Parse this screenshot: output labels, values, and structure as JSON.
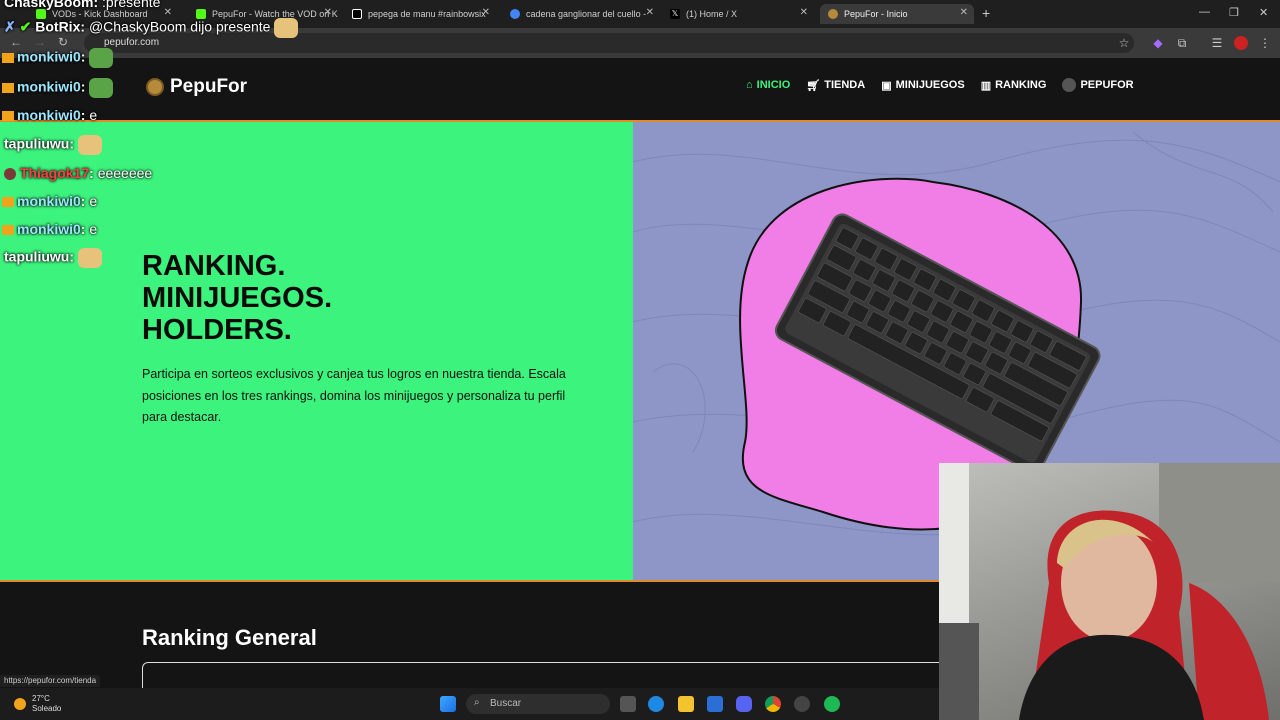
{
  "browser": {
    "tabs": [
      {
        "label": "VODs - Kick Dashboard",
        "color": "#53fc18"
      },
      {
        "label": "PepuFor - Watch the VOD on K",
        "color": "#53fc18"
      },
      {
        "label": "pepega de manu #rainbowsix",
        "color": "#ffffff"
      },
      {
        "label": "cadena ganglionar del cuello -",
        "color": "#4285f4"
      },
      {
        "label": "(1) Home / X",
        "color": "#ffffff"
      },
      {
        "label": "PepuFor - Inicio",
        "color": "#b58a3a"
      }
    ],
    "url": "pepufor.com"
  },
  "site": {
    "logo_text": "PepuFor",
    "nav": [
      {
        "label": "INICIO",
        "icon": "home-icon"
      },
      {
        "label": "TIENDA",
        "icon": "cart-icon"
      },
      {
        "label": "MINIJUEGOS",
        "icon": "gamepad-icon"
      },
      {
        "label": "RANKING",
        "icon": "chart-icon"
      },
      {
        "label": "PEPUFOR",
        "icon": "user-icon"
      }
    ],
    "hero": {
      "title_lines": [
        "RANKING.",
        "MINIJUEGOS.",
        "HOLDERS."
      ],
      "description": "Participa en sorteos exclusivos y canjea tus logros en nuestra tienda. Escala posiciones en los tres rankings, domina los minijuegos y personaliza tu perfil para destacar."
    },
    "ranking_title": "Ranking General"
  },
  "chat": [
    {
      "user": "ChaskyBoom",
      "text": ":presente",
      "color": "#ffffff"
    },
    {
      "user": "BotRix",
      "text": "@ChaskyBoom dijo presente",
      "color": "#ffffff"
    },
    {
      "user": "monkiwi0",
      "text": "",
      "color": "#9be7ff"
    },
    {
      "user": "monkiwi0",
      "text": "",
      "color": "#9be7ff"
    },
    {
      "user": "monkiwi0",
      "text": "e",
      "color": "#9be7ff"
    },
    {
      "user": "tapuliuwu",
      "text": "",
      "color": "#ffffff"
    },
    {
      "user": "Thiagok17",
      "text": "eeeeeee",
      "color": "#ff4040"
    },
    {
      "user": "monkiwi0",
      "text": "e",
      "color": "#9be7ff"
    },
    {
      "user": "monkiwi0",
      "text": "e",
      "color": "#9be7ff"
    },
    {
      "user": "tapuliuwu",
      "text": "",
      "color": "#ffffff"
    }
  ],
  "status_link": "https://pepufor.com/tienda",
  "weather": {
    "temp": "27°C",
    "desc": "Soleado"
  },
  "taskbar": {
    "search_placeholder": "Buscar"
  }
}
